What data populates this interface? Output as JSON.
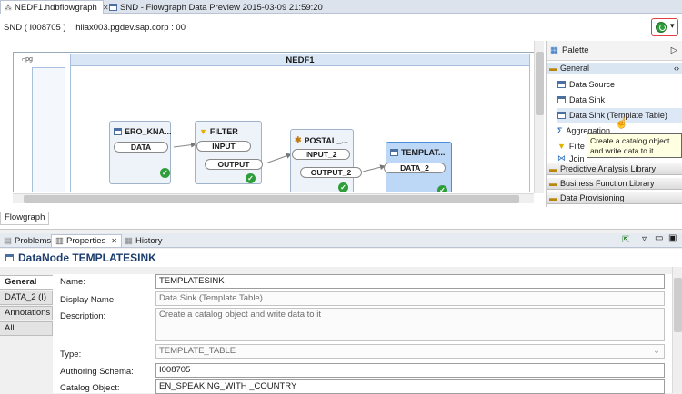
{
  "editor_tabs": [
    {
      "label": "NEDF1.hdbflowgraph",
      "active": true
    },
    {
      "label": "SND - Flowgraph Data Preview 2015-03-09 21:59:20",
      "active": false
    }
  ],
  "connection": {
    "system": "SND ( I008705 )",
    "host": "hllax003.pgdev.sap.corp : 00"
  },
  "flowgraph": {
    "title": "NEDF1",
    "nodes": {
      "source": {
        "title": "ERO_KNA...",
        "port_out": "DATA"
      },
      "filter": {
        "title": "FILTER",
        "port_in": "INPUT",
        "port_out": "OUTPUT"
      },
      "postal": {
        "title": "POSTAL_...",
        "port_in": "INPUT_2",
        "port_out": "OUTPUT_2"
      },
      "template": {
        "title": "TEMPLAT...",
        "port_in": "DATA_2"
      }
    }
  },
  "palette": {
    "title": "Palette",
    "sections": [
      {
        "label": "General",
        "open": true
      },
      {
        "label": "Predictive Analysis Library"
      },
      {
        "label": "Business Function Library"
      },
      {
        "label": "Data Provisioning"
      }
    ],
    "items": [
      "Data Source",
      "Data Sink",
      "Data Sink (Template Table)",
      "Aggregation",
      "Filte",
      "Join"
    ],
    "tooltip": "Create a catalog object and write data to it"
  },
  "editor_bottom_tab": "Flowgraph",
  "panel_tabs": [
    {
      "label": "Problems"
    },
    {
      "label": "Properties",
      "active": true
    },
    {
      "label": "History"
    }
  ],
  "properties": {
    "title": "DataNode TEMPLATESINK",
    "vtabs": [
      "General",
      "DATA_2 (I)",
      "Annotations",
      "All"
    ],
    "fields": {
      "name_label": "Name:",
      "name_value": "TEMPLATESINK",
      "display_label": "Display Name:",
      "display_value": "Data Sink (Template Table)",
      "desc_label": "Description:",
      "desc_value": "Create a catalog object and write data to it",
      "type_label": "Type:",
      "type_value": "TEMPLATE_TABLE",
      "schema_label": "Authoring Schema:",
      "schema_value": "I008705",
      "catalog_label": "Catalog Object:",
      "catalog_value": "EN_SPEAKING_WITH _COUNTRY"
    }
  },
  "colors": {
    "accent_red": "#e04040",
    "run_green": "#2e9d3a",
    "selected_node": "#bcd8f6"
  }
}
